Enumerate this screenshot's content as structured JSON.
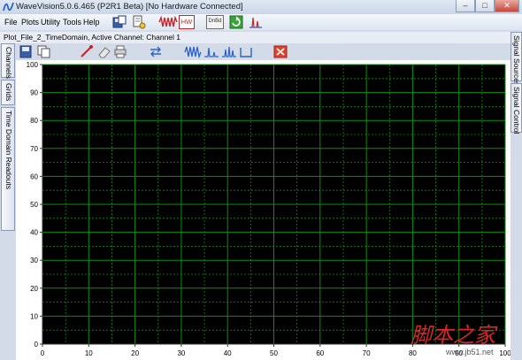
{
  "window": {
    "title": "WaveVision5.0.6.465 (P2R1 Beta)  [No Hardware Connected]",
    "controls": {
      "minimize": "–",
      "maximize": "□",
      "close": "✕"
    }
  },
  "menu": [
    "File",
    "Plots",
    "Utility",
    "Tools",
    "Help"
  ],
  "toolbar": {
    "icons": [
      "save-plot-icon",
      "open-document-icon",
      "waveform-icon",
      "hw-icon",
      "dnbd-icon",
      "refresh-icon",
      "spectrum-icon"
    ],
    "hw_label": "HW",
    "dnbd_label": "DnBd"
  },
  "plot_header": "Plot_File_2_TimeDomain,  Active Channel: Channel 1",
  "plot_toolbar": {
    "icons": [
      "save-icon",
      "copy-icon",
      "pointer-icon",
      "eraser-icon",
      "print-icon",
      "swap-icon",
      "waveform-icon",
      "spectrum-icon",
      "peaks-icon",
      "bracket-icon",
      "close-plot-icon"
    ]
  },
  "left_tabs": [
    "Channels",
    "Grids",
    "Time Domain Readouts"
  ],
  "right_tabs": [
    "Signal Sources",
    "Signal Control"
  ],
  "colors": {
    "plot_background": "#000000",
    "grid_major": "#0b8f0b",
    "grid_minor": "#0b8f0b",
    "accent": "#2a63c4"
  },
  "chart_data": {
    "type": "line",
    "series": [],
    "xlim": [
      0,
      100
    ],
    "ylim": [
      0,
      100
    ],
    "x_ticks": [
      0,
      10,
      20,
      30,
      40,
      50,
      60,
      70,
      80,
      90,
      100
    ],
    "y_ticks": [
      0,
      10,
      20,
      30,
      40,
      50,
      60,
      70,
      80,
      90,
      100
    ],
    "grid": true,
    "grid_minor": true
  },
  "watermark": {
    "chinese_text": "脚本之家",
    "url": "www.jb51.net"
  }
}
